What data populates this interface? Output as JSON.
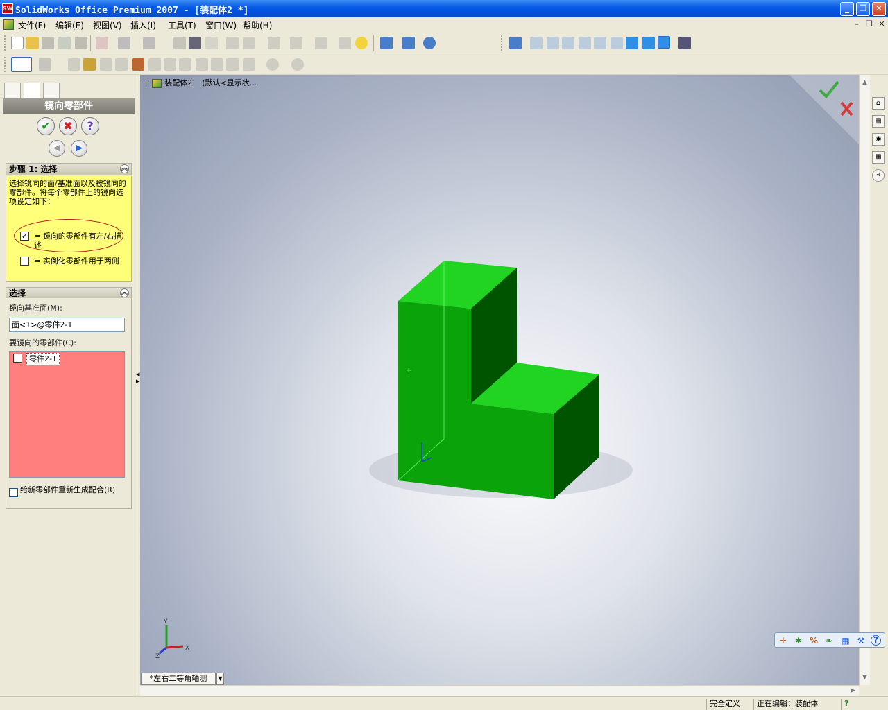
{
  "window": {
    "title": "SolidWorks Office Premium 2007 - [装配体2 *]"
  },
  "menu": {
    "items": [
      {
        "label": "文件(F)"
      },
      {
        "label": "编辑(E)"
      },
      {
        "label": "视图(V)"
      },
      {
        "label": "插入(I)"
      },
      {
        "label": "工具(T)"
      },
      {
        "label": "窗口(W)"
      },
      {
        "label": "帮助(H)"
      }
    ]
  },
  "property_manager": {
    "title": "镜向零部件",
    "step1": {
      "heading": "步骤 1: 选择",
      "description": "选择镜向的面/基准面以及被镜向的零部件。将每个零部件上的镜向选项设定如下：",
      "legend_checked": "= 镜向的零部件有左/右描述",
      "legend_unchecked": "= 实例化零部件用于两侧"
    },
    "selection": {
      "heading": "选择",
      "mirror_plane_label": "镜向基准面(M):",
      "mirror_plane_value": "面<1>@零件2-1",
      "components_label": "要镜向的零部件(C):",
      "component_item": "零件2-1",
      "recreate_mates": "给新零部件重新生成配合(R)"
    }
  },
  "feature_tree": {
    "assembly": "装配体2",
    "display_state": "(默认<显示状..."
  },
  "viewport": {
    "view_orientation": "*左右二等角轴测"
  },
  "triad": {
    "x": "X",
    "y": "Y",
    "z": "Z"
  },
  "status": {
    "definition": "完全定义",
    "editing": "正在编辑：装配体",
    "help": "?"
  },
  "colors": {
    "part_top": "#22d422",
    "part_front": "#0aa30a",
    "part_side": "#005400",
    "highlight_list": "#ff7f7f",
    "step_box": "#ffff7a"
  }
}
